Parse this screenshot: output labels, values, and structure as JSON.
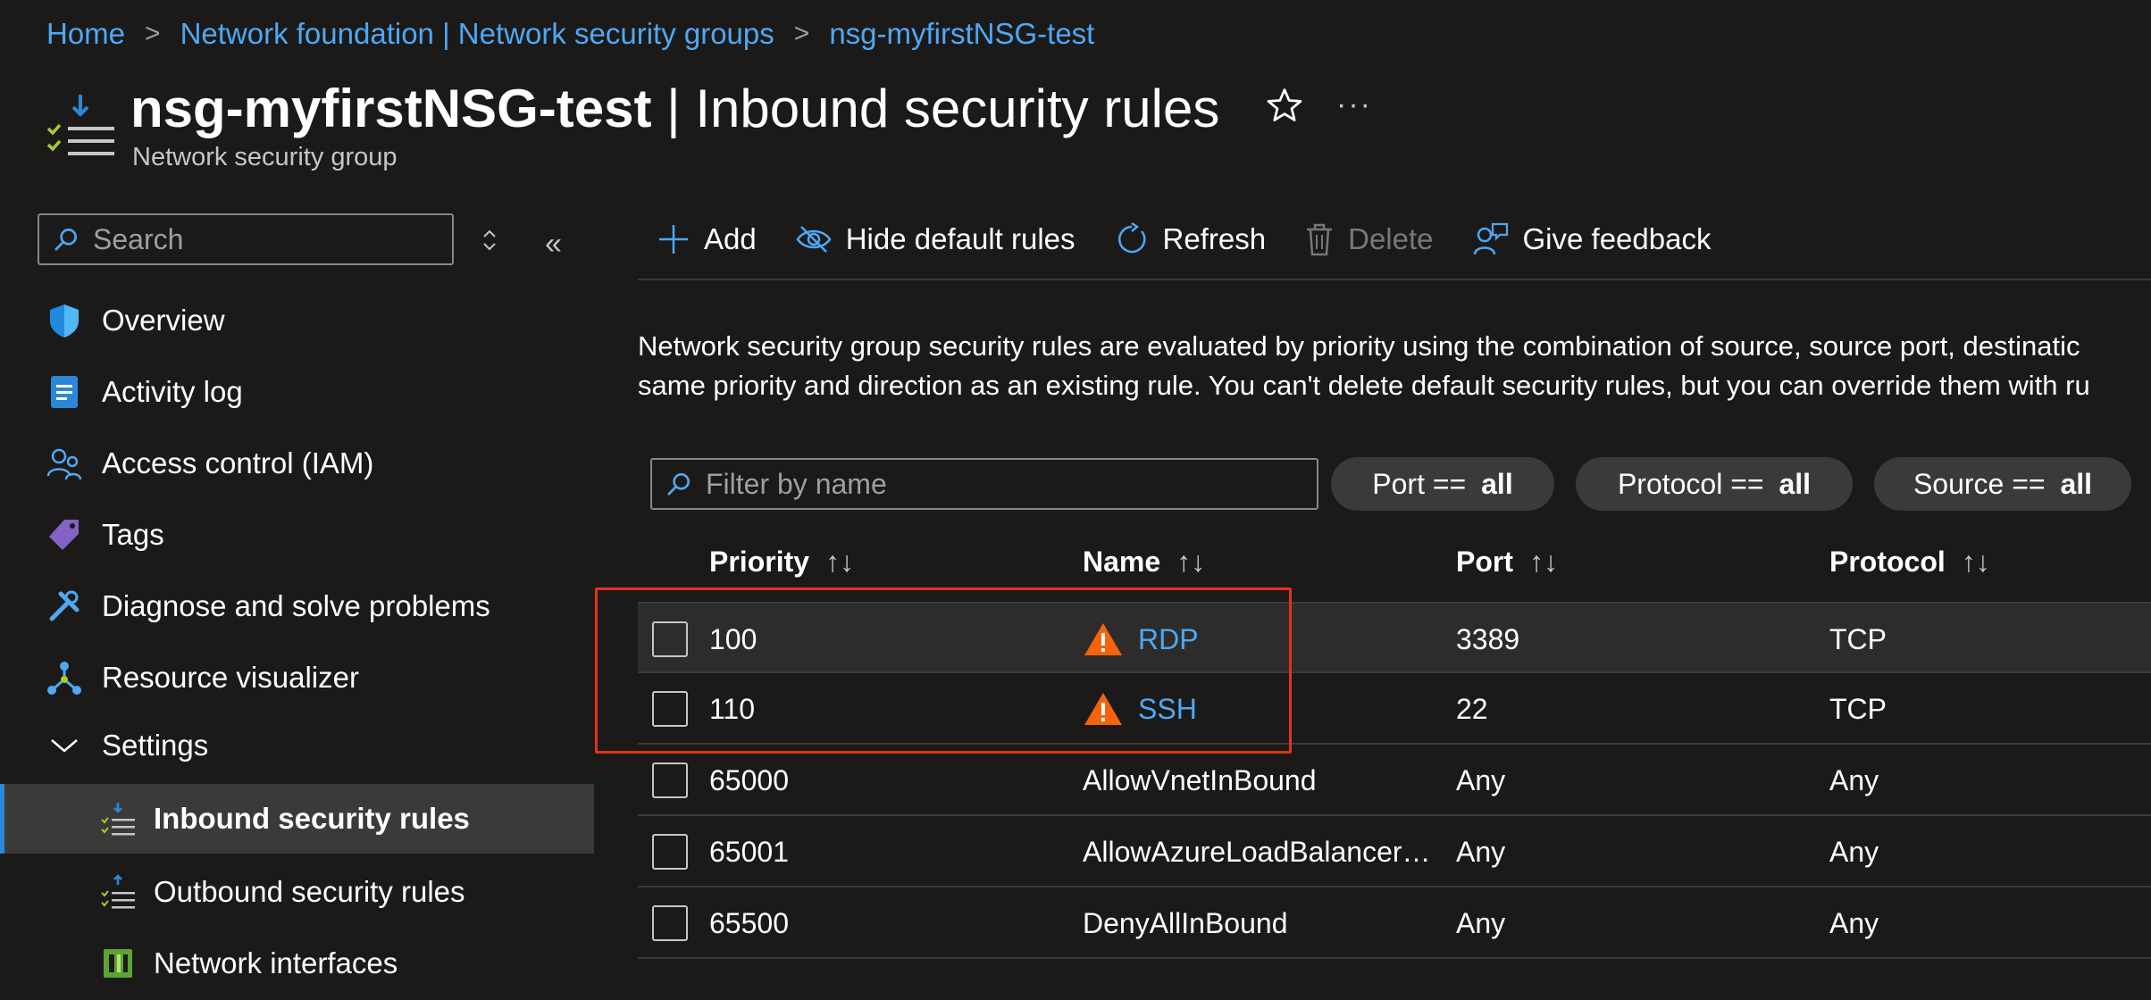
{
  "breadcrumb": {
    "home": "Home",
    "parent": "Network foundation | Network security groups",
    "current": "nsg-myfirstNSG-test"
  },
  "header": {
    "resource_name": "nsg-myfirstNSG-test",
    "separator": " | ",
    "blade_title": "Inbound security rules",
    "subtitle": "Network security group",
    "more": "···"
  },
  "sidebar": {
    "search_placeholder": "Search",
    "collapse": "«",
    "items": [
      {
        "label": "Overview",
        "icon": "shield-icon"
      },
      {
        "label": "Activity log",
        "icon": "activity-log-icon"
      },
      {
        "label": "Access control (IAM)",
        "icon": "iam-icon"
      },
      {
        "label": "Tags",
        "icon": "tag-icon"
      },
      {
        "label": "Diagnose and solve problems",
        "icon": "wrench-icon"
      },
      {
        "label": "Resource visualizer",
        "icon": "visualizer-icon"
      },
      {
        "label": "Settings",
        "icon": "chevron-down-icon"
      },
      {
        "label": "Inbound security rules",
        "icon": "inbound-rules-icon",
        "selected": true
      },
      {
        "label": "Outbound security rules",
        "icon": "outbound-rules-icon"
      },
      {
        "label": "Network interfaces",
        "icon": "network-interface-icon"
      }
    ]
  },
  "toolbar": {
    "add": "Add",
    "hide_default": "Hide default rules",
    "refresh": "Refresh",
    "delete": "Delete",
    "feedback": "Give feedback"
  },
  "description": {
    "line1": "Network security group security rules are evaluated by priority using the combination of source, source port, destinatic",
    "line2": "same priority and direction as an existing rule. You can't delete default security rules, but you can override them with ru"
  },
  "filters": {
    "name_placeholder": "Filter by name",
    "port": {
      "key": "Port == ",
      "value": "all"
    },
    "protocol": {
      "key": "Protocol == ",
      "value": "all"
    },
    "source": {
      "key": "Source == ",
      "value": "all"
    }
  },
  "table": {
    "columns": [
      "Priority",
      "Name",
      "Port",
      "Protocol"
    ],
    "sort_glyph": "↑↓",
    "rows": [
      {
        "priority": "100",
        "name": "RDP",
        "port": "3389",
        "protocol": "TCP",
        "warning": true,
        "link": true
      },
      {
        "priority": "110",
        "name": "SSH",
        "port": "22",
        "protocol": "TCP",
        "warning": true,
        "link": true
      },
      {
        "priority": "65000",
        "name": "AllowVnetInBound",
        "port": "Any",
        "protocol": "Any",
        "warning": false,
        "link": false
      },
      {
        "priority": "65001",
        "name": "AllowAzureLoadBalancerInBound",
        "port": "Any",
        "protocol": "Any",
        "warning": false,
        "link": false
      },
      {
        "priority": "65500",
        "name": "DenyAllInBound",
        "port": "Any",
        "protocol": "Any",
        "warning": false,
        "link": false
      }
    ]
  },
  "colors": {
    "background": "#1b1a19",
    "link": "#4ea8f5",
    "highlight_box": "#e2321b",
    "warning": "#f7630c",
    "selected_bar": "#2b88d8"
  }
}
